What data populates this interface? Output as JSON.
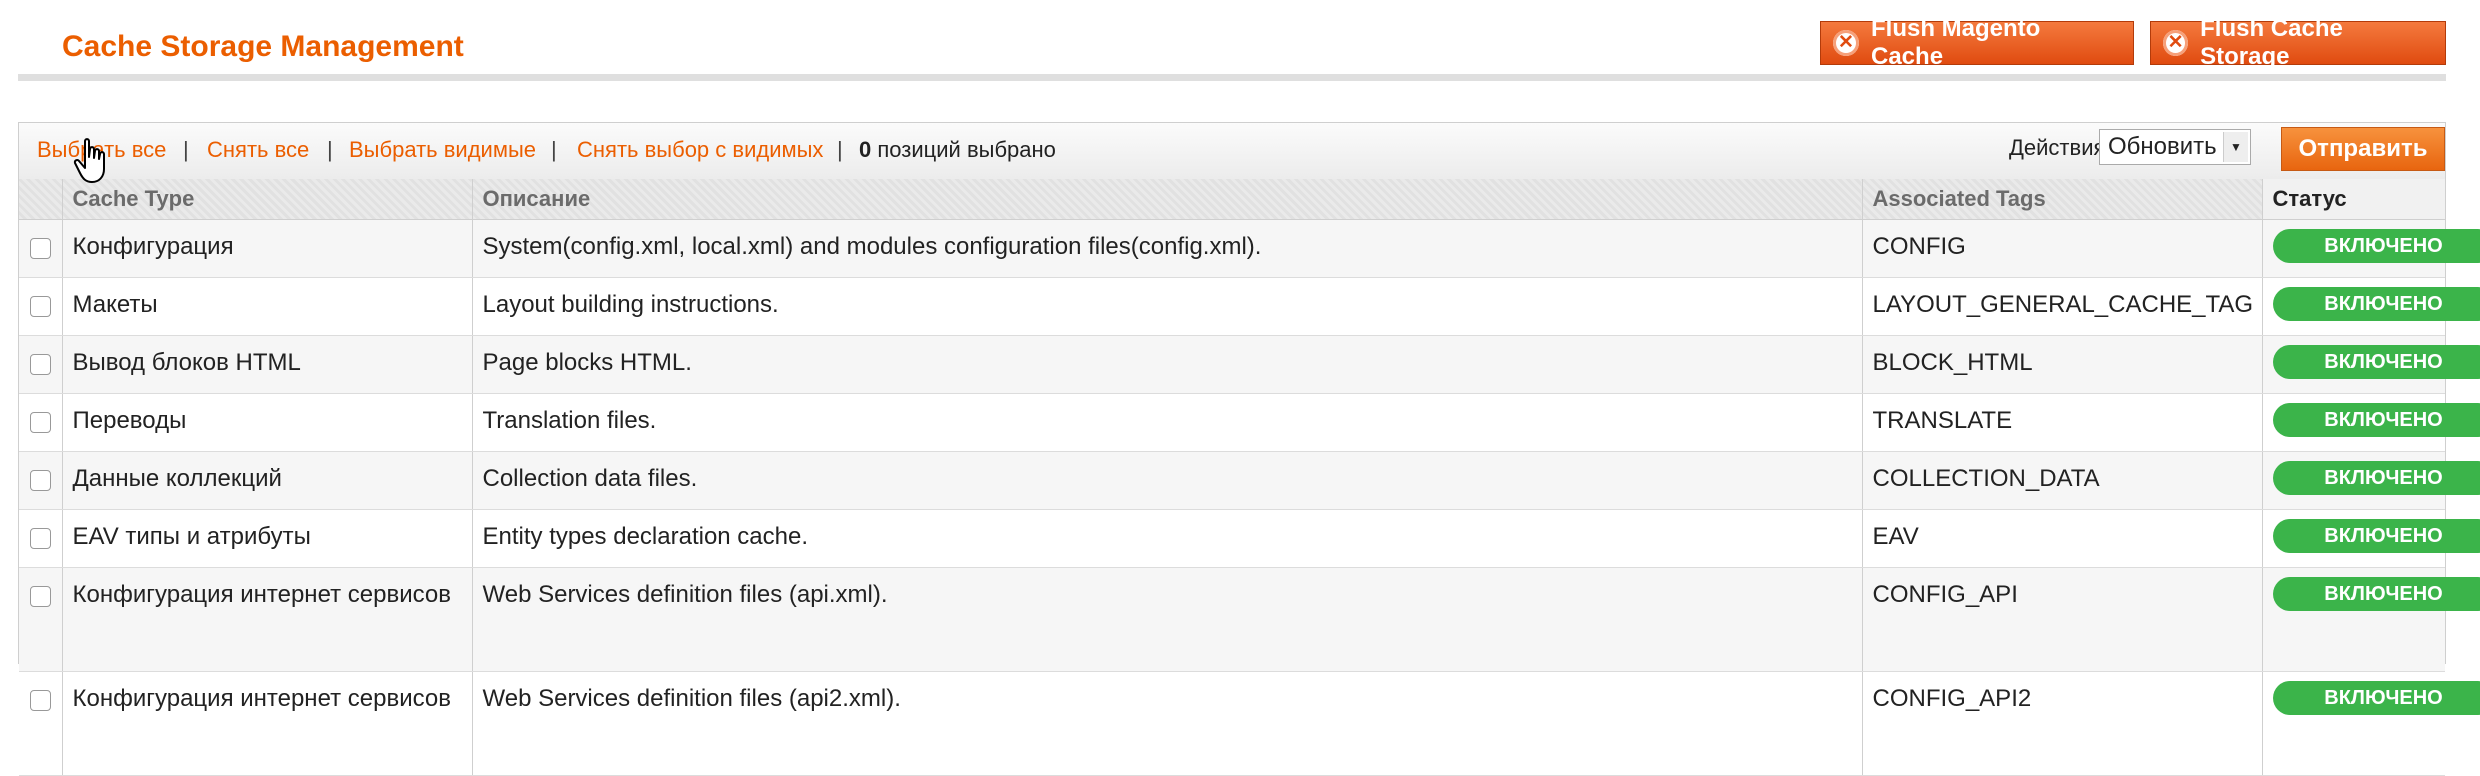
{
  "page": {
    "title": "Cache Storage Management",
    "buttons": {
      "flush_magento": "Flush Magento Cache",
      "flush_storage": "Flush Cache Storage",
      "close_glyph": "✕"
    }
  },
  "massaction": {
    "select_all": "Выбрать все",
    "unselect_all": "Снять все",
    "select_visible": "Выбрать видимые",
    "unselect_visible": "Снять выбор с видимых",
    "separator": "|",
    "count": "0",
    "count_label": "позиций выбрано",
    "actions_label": "Действия",
    "action_selected": "Обновить",
    "submit_label": "Отправить"
  },
  "table": {
    "headers": [
      "Cache Type",
      "Описание",
      "Associated Tags",
      "Статус"
    ],
    "rows": [
      {
        "type": "Конфигурация",
        "description": "System(config.xml, local.xml) and modules configuration files(config.xml).",
        "tags": "CONFIG",
        "status": "ВКЛЮЧЕНО"
      },
      {
        "type": "Макеты",
        "description": "Layout building instructions.",
        "tags": "LAYOUT_GENERAL_CACHE_TAG",
        "status": "ВКЛЮЧЕНО"
      },
      {
        "type": "Вывод блоков HTML",
        "description": "Page blocks HTML.",
        "tags": "BLOCK_HTML",
        "status": "ВКЛЮЧЕНО"
      },
      {
        "type": "Переводы",
        "description": "Translation files.",
        "tags": "TRANSLATE",
        "status": "ВКЛЮЧЕНО"
      },
      {
        "type": "Данные коллекций",
        "description": "Collection data files.",
        "tags": "COLLECTION_DATA",
        "status": "ВКЛЮЧЕНО"
      },
      {
        "type": "EAV типы и атрибуты",
        "description": "Entity types declaration cache.",
        "tags": "EAV",
        "status": "ВКЛЮЧЕНО"
      },
      {
        "type": "Конфигурация интернет сервисов",
        "description": "Web Services definition files (api.xml).",
        "tags": "CONFIG_API",
        "status": "ВКЛЮЧЕНО"
      },
      {
        "type": "Конфигурация интернет сервисов",
        "description": "Web Services definition files (api2.xml).",
        "tags": "CONFIG_API2",
        "status": "ВКЛЮЧЕНО"
      }
    ]
  },
  "colors": {
    "accent": "#eb5e00",
    "status_enabled": "#3bb44a",
    "button": "#e8650f"
  }
}
